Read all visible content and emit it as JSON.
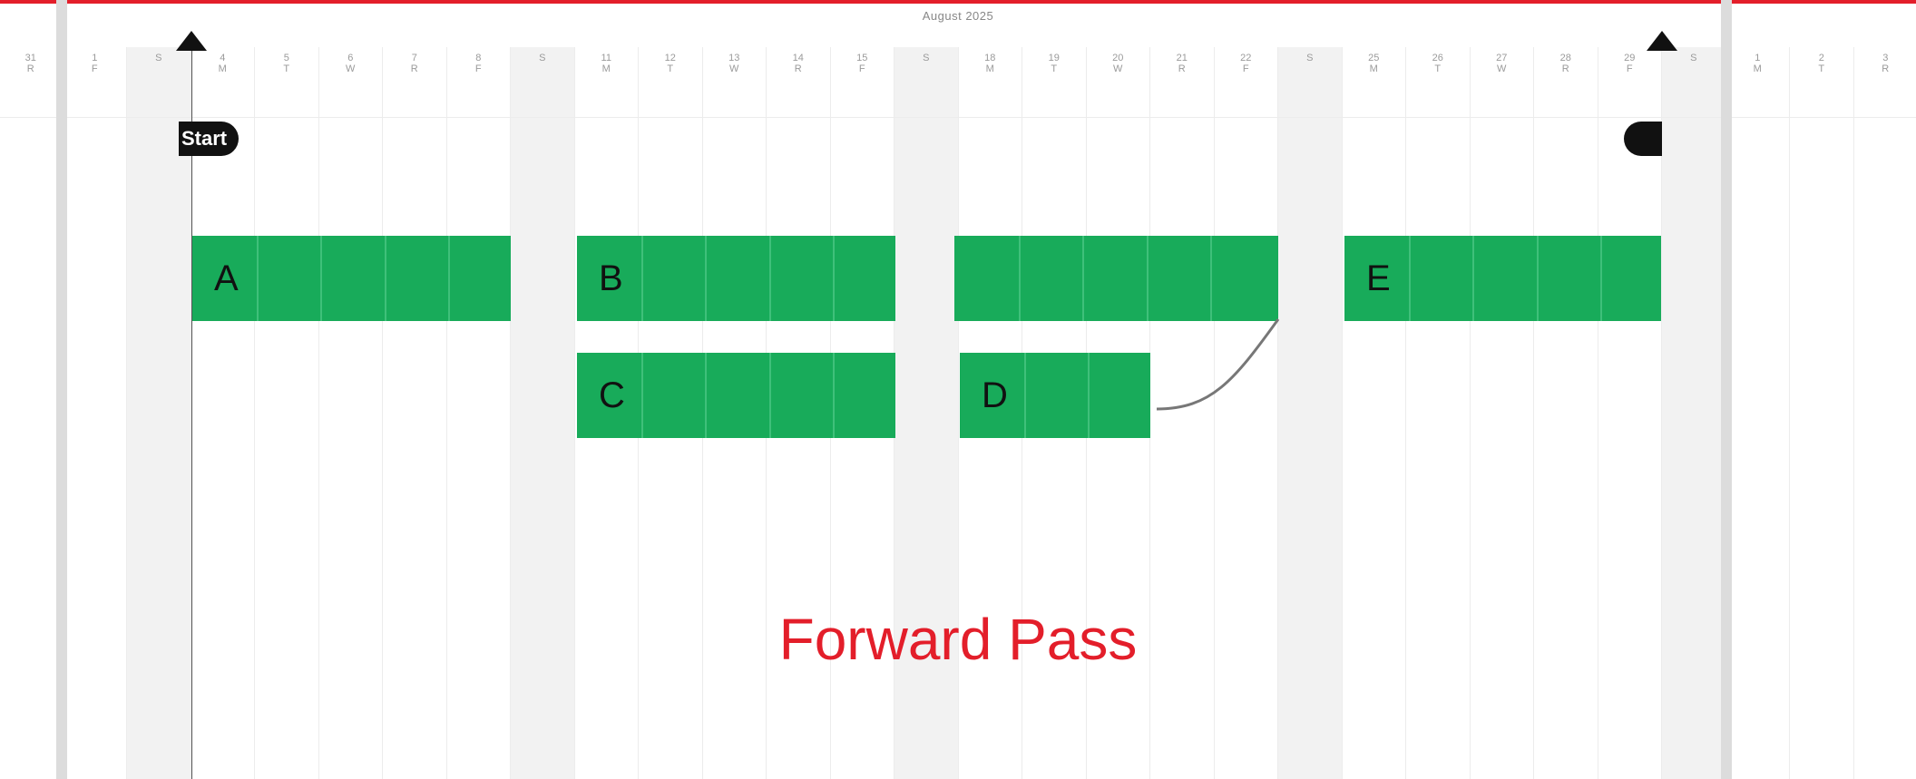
{
  "header": {
    "month_label": "August 2025"
  },
  "days": [
    {
      "d": "31",
      "w": "R",
      "weekend": false
    },
    {
      "d": "1",
      "w": "F",
      "weekend": false
    },
    {
      "d": "",
      "w": "S",
      "weekend": true
    },
    {
      "d": "4",
      "w": "M",
      "weekend": false
    },
    {
      "d": "5",
      "w": "T",
      "weekend": false
    },
    {
      "d": "6",
      "w": "W",
      "weekend": false
    },
    {
      "d": "7",
      "w": "R",
      "weekend": false
    },
    {
      "d": "8",
      "w": "F",
      "weekend": false
    },
    {
      "d": "",
      "w": "S",
      "weekend": true
    },
    {
      "d": "11",
      "w": "M",
      "weekend": false
    },
    {
      "d": "12",
      "w": "T",
      "weekend": false
    },
    {
      "d": "13",
      "w": "W",
      "weekend": false
    },
    {
      "d": "14",
      "w": "R",
      "weekend": false
    },
    {
      "d": "15",
      "w": "F",
      "weekend": false
    },
    {
      "d": "",
      "w": "S",
      "weekend": true
    },
    {
      "d": "18",
      "w": "M",
      "weekend": false
    },
    {
      "d": "19",
      "w": "T",
      "weekend": false
    },
    {
      "d": "20",
      "w": "W",
      "weekend": false
    },
    {
      "d": "21",
      "w": "R",
      "weekend": false
    },
    {
      "d": "22",
      "w": "F",
      "weekend": false
    },
    {
      "d": "",
      "w": "S",
      "weekend": true
    },
    {
      "d": "25",
      "w": "M",
      "weekend": false
    },
    {
      "d": "26",
      "w": "T",
      "weekend": false
    },
    {
      "d": "27",
      "w": "W",
      "weekend": false
    },
    {
      "d": "28",
      "w": "R",
      "weekend": false
    },
    {
      "d": "29",
      "w": "F",
      "weekend": false
    },
    {
      "d": "",
      "w": "S",
      "weekend": true
    },
    {
      "d": "1",
      "w": "M",
      "weekend": false
    },
    {
      "d": "2",
      "w": "T",
      "weekend": false
    },
    {
      "d": "3",
      "w": "R",
      "weekend": false
    }
  ],
  "milestones": {
    "start_label": "Start"
  },
  "tasks": [
    {
      "name": "A"
    },
    {
      "name": "B"
    },
    {
      "name": "C"
    },
    {
      "name": "D"
    },
    {
      "name": "E"
    }
  ],
  "caption": "Forward Pass",
  "colors": {
    "accent": "#e31e2a",
    "task": "#18ab5a",
    "milestone": "#111111"
  },
  "icons": {
    "start_marker": "triangle-up-icon",
    "end_marker": "triangle-up-icon"
  }
}
